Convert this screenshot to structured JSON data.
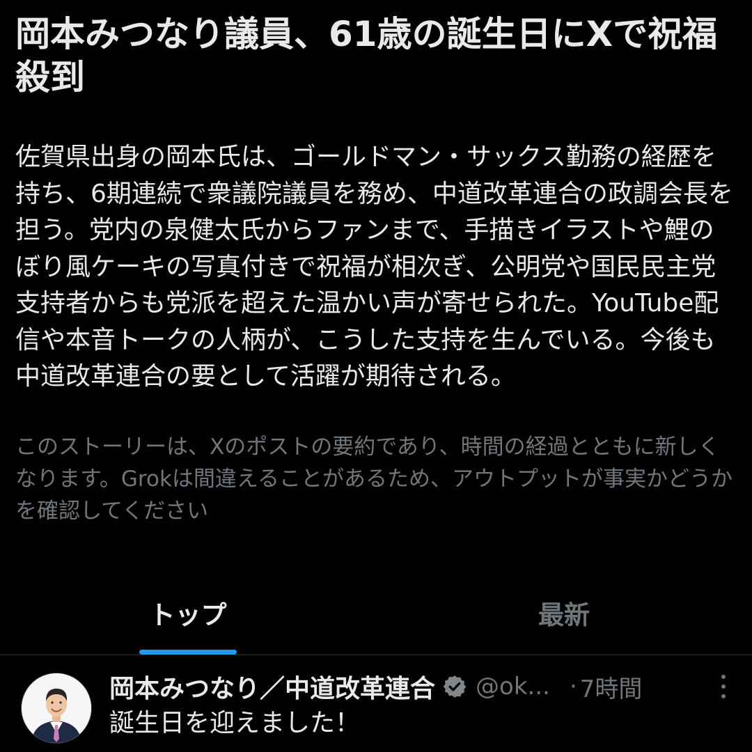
{
  "story": {
    "headline": "岡本みつなり議員、61歳の誕生日にXで祝福殺到",
    "summary": "佐賀県出身の岡本氏は、ゴールドマン・サックス勤務の経歴を持ち、6期連続で衆議院議員を務め、中道改革連合の政調会長を担う。党内の泉健太氏からファンまで、手描きイラストや鯉のぼり風ケーキの写真付きで祝福が相次ぎ、公明党や国民民主党支持者からも党派を超えた温かい声が寄せられた。YouTube配信や本音トークの人柄が、こうした支持を生んでいる。今後も中道改革連合の要として活躍が期待される。",
    "disclaimer": "このストーリーは、Xのポストの要約であり、時間の経過とともに新しくなります。Grokは間違えることがあるため、アウトプットが事実かどうかを確認してください"
  },
  "tabs": [
    {
      "label": "トップ",
      "active": true
    },
    {
      "label": "最新",
      "active": false
    }
  ],
  "post": {
    "author": "岡本みつなり／中道改革連合",
    "handle": "@ok...",
    "separator": "·",
    "time": "7時間",
    "text": "誕生日を迎えました！",
    "verified_icon": "verified-badge-icon",
    "more_icon": "more-vertical-icon"
  },
  "colors": {
    "background": "#000000",
    "text": "#e7e9ea",
    "muted": "#71767b",
    "accent": "#1d9bf0",
    "divider": "#2f3336"
  }
}
